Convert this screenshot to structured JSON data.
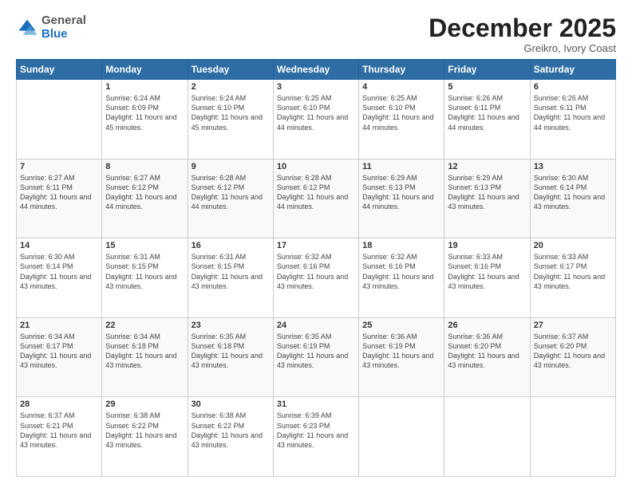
{
  "logo": {
    "general": "General",
    "blue": "Blue"
  },
  "title": "December 2025",
  "location": "Greikro, Ivory Coast",
  "days_of_week": [
    "Sunday",
    "Monday",
    "Tuesday",
    "Wednesday",
    "Thursday",
    "Friday",
    "Saturday"
  ],
  "weeks": [
    [
      {
        "day": "",
        "info": ""
      },
      {
        "day": "1",
        "info": "Sunrise: 6:24 AM\nSunset: 6:09 PM\nDaylight: 11 hours and 45 minutes."
      },
      {
        "day": "2",
        "info": "Sunrise: 6:24 AM\nSunset: 6:10 PM\nDaylight: 11 hours and 45 minutes."
      },
      {
        "day": "3",
        "info": "Sunrise: 6:25 AM\nSunset: 6:10 PM\nDaylight: 11 hours and 44 minutes."
      },
      {
        "day": "4",
        "info": "Sunrise: 6:25 AM\nSunset: 6:10 PM\nDaylight: 11 hours and 44 minutes."
      },
      {
        "day": "5",
        "info": "Sunrise: 6:26 AM\nSunset: 6:11 PM\nDaylight: 11 hours and 44 minutes."
      },
      {
        "day": "6",
        "info": "Sunrise: 6:26 AM\nSunset: 6:11 PM\nDaylight: 11 hours and 44 minutes."
      }
    ],
    [
      {
        "day": "7",
        "info": "Sunrise: 6:27 AM\nSunset: 6:11 PM\nDaylight: 11 hours and 44 minutes."
      },
      {
        "day": "8",
        "info": "Sunrise: 6:27 AM\nSunset: 6:12 PM\nDaylight: 11 hours and 44 minutes."
      },
      {
        "day": "9",
        "info": "Sunrise: 6:28 AM\nSunset: 6:12 PM\nDaylight: 11 hours and 44 minutes."
      },
      {
        "day": "10",
        "info": "Sunrise: 6:28 AM\nSunset: 6:12 PM\nDaylight: 11 hours and 44 minutes."
      },
      {
        "day": "11",
        "info": "Sunrise: 6:29 AM\nSunset: 6:13 PM\nDaylight: 11 hours and 44 minutes."
      },
      {
        "day": "12",
        "info": "Sunrise: 6:29 AM\nSunset: 6:13 PM\nDaylight: 11 hours and 43 minutes."
      },
      {
        "day": "13",
        "info": "Sunrise: 6:30 AM\nSunset: 6:14 PM\nDaylight: 11 hours and 43 minutes."
      }
    ],
    [
      {
        "day": "14",
        "info": "Sunrise: 6:30 AM\nSunset: 6:14 PM\nDaylight: 11 hours and 43 minutes."
      },
      {
        "day": "15",
        "info": "Sunrise: 6:31 AM\nSunset: 6:15 PM\nDaylight: 11 hours and 43 minutes."
      },
      {
        "day": "16",
        "info": "Sunrise: 6:31 AM\nSunset: 6:15 PM\nDaylight: 11 hours and 43 minutes."
      },
      {
        "day": "17",
        "info": "Sunrise: 6:32 AM\nSunset: 6:16 PM\nDaylight: 11 hours and 43 minutes."
      },
      {
        "day": "18",
        "info": "Sunrise: 6:32 AM\nSunset: 6:16 PM\nDaylight: 11 hours and 43 minutes."
      },
      {
        "day": "19",
        "info": "Sunrise: 6:33 AM\nSunset: 6:16 PM\nDaylight: 11 hours and 43 minutes."
      },
      {
        "day": "20",
        "info": "Sunrise: 6:33 AM\nSunset: 6:17 PM\nDaylight: 11 hours and 43 minutes."
      }
    ],
    [
      {
        "day": "21",
        "info": "Sunrise: 6:34 AM\nSunset: 6:17 PM\nDaylight: 11 hours and 43 minutes."
      },
      {
        "day": "22",
        "info": "Sunrise: 6:34 AM\nSunset: 6:18 PM\nDaylight: 11 hours and 43 minutes."
      },
      {
        "day": "23",
        "info": "Sunrise: 6:35 AM\nSunset: 6:18 PM\nDaylight: 11 hours and 43 minutes."
      },
      {
        "day": "24",
        "info": "Sunrise: 6:35 AM\nSunset: 6:19 PM\nDaylight: 11 hours and 43 minutes."
      },
      {
        "day": "25",
        "info": "Sunrise: 6:36 AM\nSunset: 6:19 PM\nDaylight: 11 hours and 43 minutes."
      },
      {
        "day": "26",
        "info": "Sunrise: 6:36 AM\nSunset: 6:20 PM\nDaylight: 11 hours and 43 minutes."
      },
      {
        "day": "27",
        "info": "Sunrise: 6:37 AM\nSunset: 6:20 PM\nDaylight: 11 hours and 43 minutes."
      }
    ],
    [
      {
        "day": "28",
        "info": "Sunrise: 6:37 AM\nSunset: 6:21 PM\nDaylight: 11 hours and 43 minutes."
      },
      {
        "day": "29",
        "info": "Sunrise: 6:38 AM\nSunset: 6:22 PM\nDaylight: 11 hours and 43 minutes."
      },
      {
        "day": "30",
        "info": "Sunrise: 6:38 AM\nSunset: 6:22 PM\nDaylight: 11 hours and 43 minutes."
      },
      {
        "day": "31",
        "info": "Sunrise: 6:39 AM\nSunset: 6:23 PM\nDaylight: 11 hours and 43 minutes."
      },
      {
        "day": "",
        "info": ""
      },
      {
        "day": "",
        "info": ""
      },
      {
        "day": "",
        "info": ""
      }
    ]
  ]
}
